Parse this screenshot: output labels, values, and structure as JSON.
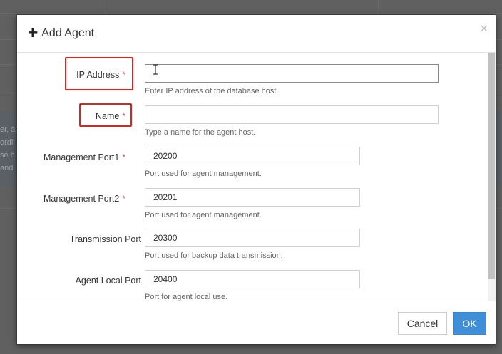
{
  "background": {
    "snippets": [
      "er, a",
      "ordi",
      "se h",
      "and"
    ]
  },
  "dialog": {
    "title": "Add Agent",
    "title_icon": "plus-icon",
    "close_symbol": "×",
    "fields": [
      {
        "label": "IP Address",
        "required": "*",
        "value": "",
        "help": "Enter IP address of the database host."
      },
      {
        "label": "Name",
        "required": "*",
        "value": "",
        "help": "Type a name for the agent host."
      },
      {
        "label": "Management Port1",
        "required": "*",
        "value": "20200",
        "help": "Port used for agent management."
      },
      {
        "label": "Management Port2",
        "required": "*",
        "value": "20201",
        "help": "Port used for agent management."
      },
      {
        "label": "Transmission Port",
        "required": "",
        "value": "20300",
        "help": "Port used for backup data transmission."
      },
      {
        "label": "Agent Local Port",
        "required": "",
        "value": "20400",
        "help": "Port for agent local use."
      }
    ],
    "buttons": {
      "cancel": "Cancel",
      "ok": "OK"
    }
  },
  "colors": {
    "accent": "#3f8ed8",
    "required": "#d9534f",
    "highlight": "#e0231c"
  }
}
